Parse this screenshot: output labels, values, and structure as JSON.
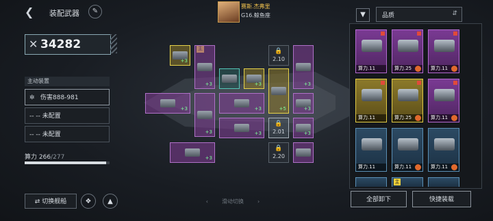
{
  "header": {
    "title": "装配武器",
    "pilot_name": "赛斯.杰弗里",
    "ship_info": "G16.鲸鱼座"
  },
  "sort": {
    "label": "品质"
  },
  "power": {
    "value": "34282"
  },
  "sections": {
    "active_title": "主动装置"
  },
  "slots": [
    {
      "label": "伤害888-981"
    },
    {
      "label": "-- -- 未配置"
    },
    {
      "label": "-- -- 未配置"
    }
  ],
  "meter": {
    "label": "算力",
    "current": "266",
    "max": "/277",
    "fraction": 0.96
  },
  "buttons": {
    "switch_ship": "切换舰船",
    "unload_all": "全部卸下",
    "quick_equip": "快捷装载",
    "swipe_hint": "滑动切换"
  },
  "grid": {
    "main_badge": "主",
    "plus": "+3",
    "plus_alt": "+5",
    "locks": [
      "2.10",
      "2.01",
      "2.20"
    ]
  },
  "inventory": {
    "cards": [
      {
        "label": "算力.11"
      },
      {
        "label": "算力.25"
      },
      {
        "label": "算力.11"
      },
      {
        "label": "算力.11"
      },
      {
        "label": "算力.25"
      },
      {
        "label": "算力.11"
      },
      {
        "label": "算力.11"
      },
      {
        "label": "算力.11"
      },
      {
        "label": "算力.11"
      }
    ],
    "badge": "主",
    "stat": "+3"
  }
}
